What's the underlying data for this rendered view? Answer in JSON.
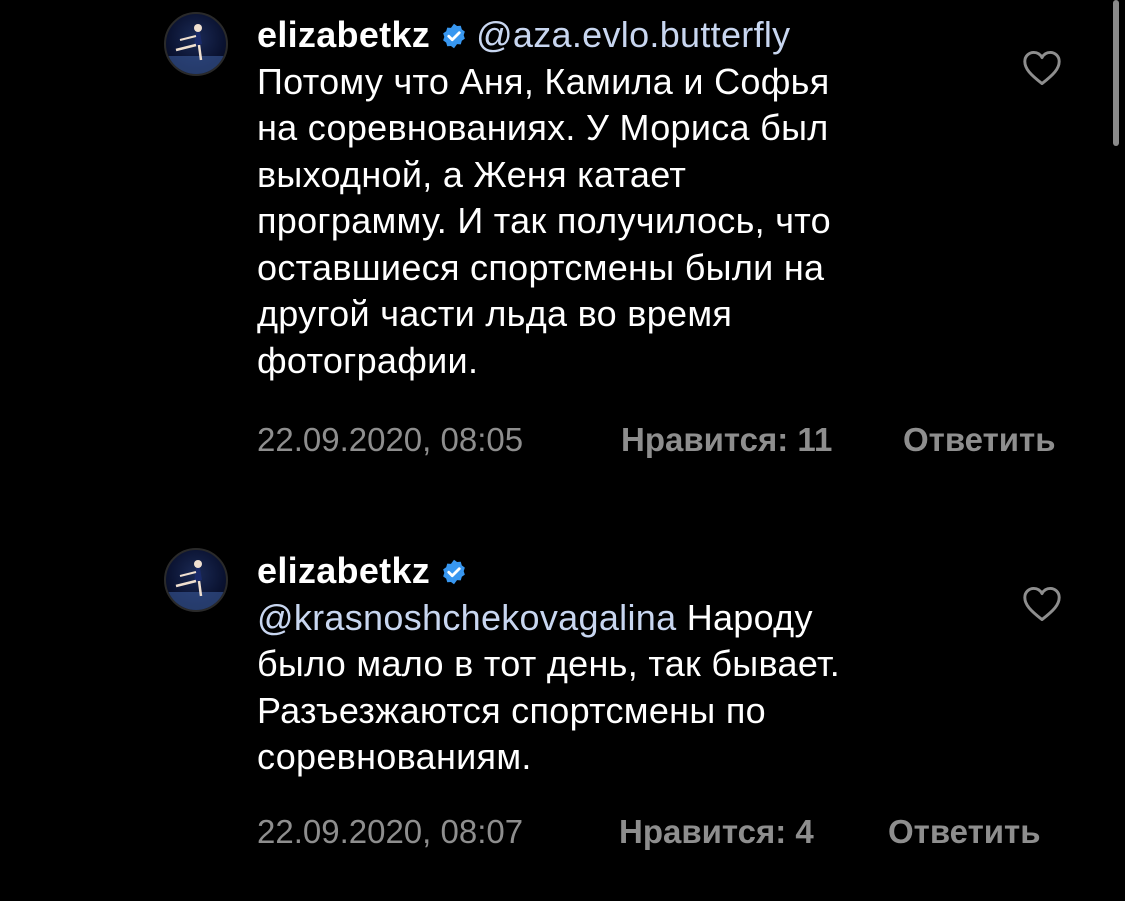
{
  "comments": [
    {
      "username": "elizabetkz",
      "verified": true,
      "mention": "@aza.evlo.butterfly",
      "text_lines": [
        "Потому что Аня, Камила и Софья",
        "на соревнованиях. У Мориса был",
        "выходной, а Женя катает",
        "программу. И так получилось, что",
        "оставшиеся спортсмены были на",
        "другой части льда во время",
        "фотографии."
      ],
      "timestamp": "22.09.2020, 08:05",
      "likes": "Нравится: 11",
      "reply": "Ответить",
      "like_icon": "heart-outline-icon"
    },
    {
      "username": "elizabetkz",
      "verified": true,
      "mention": "@krasnoshchekovagalina",
      "mention_tail": " Народу",
      "text_lines": [
        "было мало в тот день, так бывает.",
        "Разъезжаются спортсмены по",
        "соревнованиям."
      ],
      "timestamp": "22.09.2020, 08:07",
      "likes": "Нравится: 4",
      "reply": "Ответить",
      "like_icon": "heart-outline-icon"
    }
  ],
  "colors": {
    "background": "#000000",
    "text": "#ffffff",
    "meta": "#8e8e8e",
    "verified": "#3897f0",
    "mention": "#c8d6f0"
  }
}
